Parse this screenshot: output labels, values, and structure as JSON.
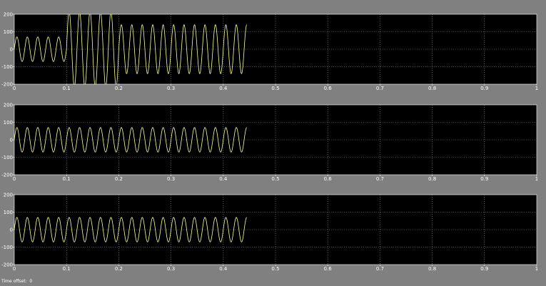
{
  "footer": {
    "time_offset_label": "Time offset:",
    "time_offset_value": "0"
  },
  "colors": {
    "background": "#808080",
    "plot_background": "#000000",
    "trace": "#ffff99",
    "grid": "#a0a0a0",
    "axis_text": "#ffffff"
  },
  "chart_data": [
    {
      "type": "line",
      "title": "",
      "xlabel": "",
      "ylabel": "",
      "xlim": [
        0,
        1
      ],
      "ylim": [
        -200,
        200
      ],
      "x_ticks": [
        0,
        0.1,
        0.2,
        0.3,
        0.4,
        0.5,
        0.6,
        0.7,
        0.8,
        0.9,
        1
      ],
      "x_tick_labels": [
        "0",
        "0.1",
        "0.2",
        "0.3",
        "0.4",
        "0.5",
        "0.6",
        "0.7",
        "0.8",
        "0.9",
        "1"
      ],
      "y_ticks": [
        -200,
        -100,
        0,
        100,
        200
      ],
      "y_tick_labels": [
        "-200",
        "-100",
        "0",
        "100",
        "200"
      ],
      "grid": true,
      "series": [
        {
          "frequency_hz": 50,
          "segments": [
            {
              "t_start": 0,
              "t_end": 0.1,
              "amplitude": 70,
              "offset": 0
            },
            {
              "t_start": 0.1,
              "t_end": 0.2,
              "amplitude": 215,
              "offset": 0
            },
            {
              "t_start": 0.2,
              "t_end": 0.445,
              "amplitude": 140,
              "offset": 0
            }
          ]
        }
      ]
    },
    {
      "type": "line",
      "title": "",
      "xlabel": "",
      "ylabel": "",
      "xlim": [
        0,
        1
      ],
      "ylim": [
        -200,
        200
      ],
      "x_ticks": [
        0,
        0.1,
        0.2,
        0.3,
        0.4,
        0.5,
        0.6,
        0.7,
        0.8,
        0.9,
        1
      ],
      "x_tick_labels": [
        "0",
        "0.1",
        "0.2",
        "0.3",
        "0.4",
        "0.5",
        "0.6",
        "0.7",
        "0.8",
        "0.9",
        "1"
      ],
      "y_ticks": [
        -200,
        -100,
        0,
        100,
        200
      ],
      "y_tick_labels": [
        "-200",
        "-100",
        "0",
        "100",
        "200"
      ],
      "grid": true,
      "series": [
        {
          "frequency_hz": 50,
          "segments": [
            {
              "t_start": 0,
              "t_end": 0.445,
              "amplitude": 70,
              "offset": 0
            }
          ]
        }
      ]
    },
    {
      "type": "line",
      "title": "",
      "xlabel": "",
      "ylabel": "",
      "xlim": [
        0,
        1
      ],
      "ylim": [
        -200,
        200
      ],
      "x_ticks": [
        0,
        0.1,
        0.2,
        0.3,
        0.4,
        0.5,
        0.6,
        0.7,
        0.8,
        0.9,
        1
      ],
      "x_tick_labels": [
        "0",
        "0.1",
        "0.2",
        "0.3",
        "0.4",
        "0.5",
        "0.6",
        "0.7",
        "0.8",
        "0.9",
        "1"
      ],
      "y_ticks": [
        -200,
        -100,
        0,
        100,
        200
      ],
      "y_tick_labels": [
        "-200",
        "-100",
        "0",
        "100",
        "200"
      ],
      "grid": true,
      "series": [
        {
          "frequency_hz": 50,
          "segments": [
            {
              "t_start": 0,
              "t_end": 0.445,
              "amplitude": 70,
              "offset": 0
            }
          ]
        }
      ]
    }
  ]
}
